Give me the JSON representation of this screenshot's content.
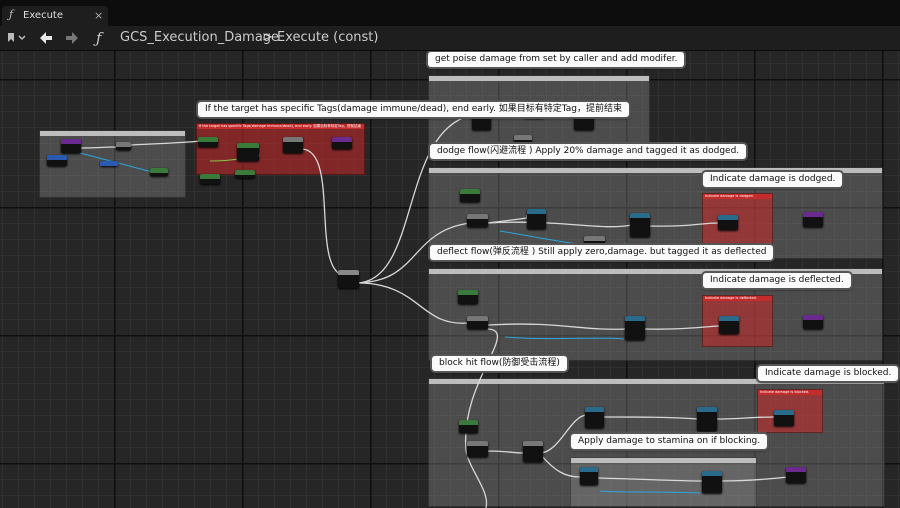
{
  "tab": {
    "title": "Execute",
    "close": "×",
    "icon_glyph": "ƒ"
  },
  "toolbar": {
    "back_icon": "arrow-left-icon",
    "forward_icon": "arrow-right-icon",
    "fn_glyph": "ƒ"
  },
  "breadcrumb": {
    "graph_name": "GCS_Execution_Damage",
    "separator": ">",
    "function_name": "Execute (const)"
  },
  "comments": {
    "poise": "get poise damage from set by caller and add modifer.",
    "tags": "If the target has specific Tags(damage immune/dead), end early. 如果目标有特定Tag，提前结束",
    "dodge": "dodge flow(闪避流程 ) Apply 20% damage and tagged it as dodged.",
    "dodged": "Indicate damage is dodged.",
    "deflect": "deflect flow(弹反流程 ) Still apply zero,damage. but tagged it as deflected",
    "deflected": "Indicate damage is deflected.",
    "block": "block hit flow(防御受击流程)",
    "blocked": "Indicate damage is blocked.",
    "stamina": "Apply damage to stamina on if blocking."
  },
  "mini_labels": {
    "tags_box": "If the target has specific Tags(damage immune/dead), end early. 如果目标有特定Tag，提前结束",
    "dodged_box": "Indicate damage is dodged.",
    "deflected_box": "Indicate damage is deflected.",
    "blocked_box": "Indicate damage is blocked."
  },
  "colors": {
    "comment_gray": "#969696",
    "comment_red": "#cd2828",
    "exec_wire": "#d8d8d8",
    "float_pin": "#2aa7e0",
    "bool_pin": "#8bc34a",
    "struct_pin": "#6b2a8f"
  }
}
